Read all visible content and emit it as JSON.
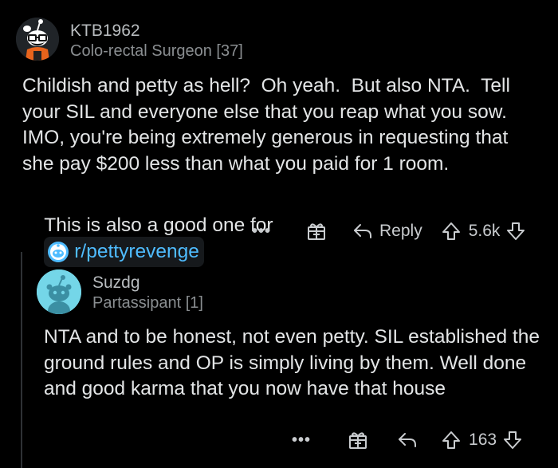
{
  "comment": {
    "username": "KTB1962",
    "flair": "Colo-rectal Surgeon [37]",
    "paragraph1": "Childish and petty as hell?  Oh yeah.  But also NTA.  Tell your SIL and everyone else that you reap what you sow. IMO, you're being extremely generous in requesting that she pay $200 less than what you paid for 1 room.",
    "paragraph2_prefix": "This is also a good one for",
    "subreddit_link": "r/pettyrevenge",
    "more_label": "•••",
    "reply_label": "Reply",
    "upvote_count": "5.6k",
    "avatar_icon": "snoo-avatar-icon"
  },
  "reply": {
    "username": "Suzdg",
    "flair": "Partassipant [1]",
    "body": "NTA and to be honest, not even petty. SIL established the ground rules and OP is simply living by them. Well done and good karma that you now have that house",
    "more_label": "•••",
    "upvote_count": "163",
    "avatar_icon": "default-snoo-avatar-icon"
  },
  "colors": {
    "background": "#000000",
    "text": "#e3e5e6",
    "muted": "#8a8e91",
    "link": "#4fbcff",
    "default_avatar": "#74d6e8"
  }
}
